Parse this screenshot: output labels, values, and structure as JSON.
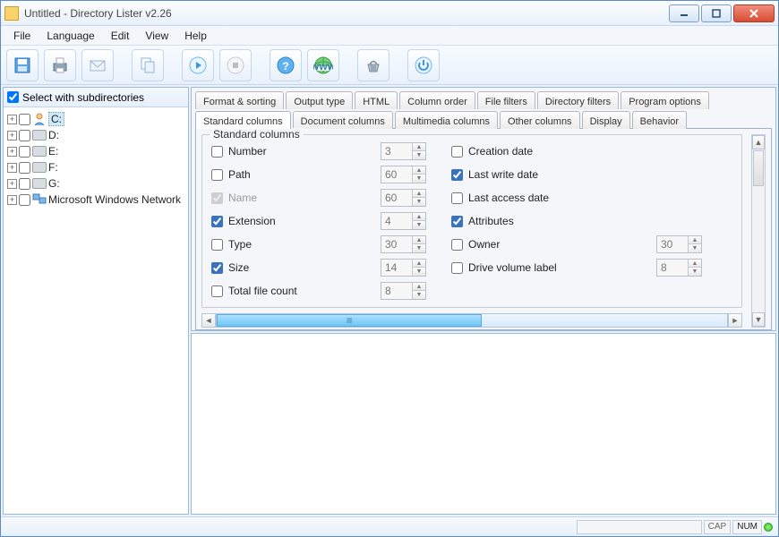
{
  "window": {
    "title": "Untitled - Directory Lister v2.26"
  },
  "menubar": [
    "File",
    "Language",
    "Edit",
    "View",
    "Help"
  ],
  "leftpanel": {
    "checkbox_label": "Select with subdirectories",
    "checkbox_checked": true,
    "tree": [
      {
        "label": "C:",
        "type": "user-drive",
        "selected": true
      },
      {
        "label": "D:",
        "type": "drive"
      },
      {
        "label": "E:",
        "type": "drive"
      },
      {
        "label": "F:",
        "type": "drive"
      },
      {
        "label": "G:",
        "type": "drive"
      },
      {
        "label": "Microsoft Windows Network",
        "type": "network"
      }
    ]
  },
  "tabs_row1": [
    "Format & sorting",
    "Output type",
    "HTML",
    "Column order",
    "File filters",
    "Directory filters",
    "Program options"
  ],
  "tabs_row2": [
    "Standard columns",
    "Document columns",
    "Multimedia columns",
    "Other columns",
    "Display",
    "Behavior"
  ],
  "active_tab": "Standard columns",
  "groupbox_title": "Standard columns",
  "left_fields": [
    {
      "label": "Number",
      "checked": false,
      "value": "3"
    },
    {
      "label": "Path",
      "checked": false,
      "value": "60"
    },
    {
      "label": "Name",
      "checked": true,
      "disabled": true,
      "value": "60"
    },
    {
      "label": "Extension",
      "checked": true,
      "value": "4"
    },
    {
      "label": "Type",
      "checked": false,
      "value": "30"
    },
    {
      "label": "Size",
      "checked": true,
      "value": "14"
    },
    {
      "label": "Total file count",
      "checked": false,
      "value": "8"
    }
  ],
  "right_fields": [
    {
      "label": "Creation date",
      "checked": false
    },
    {
      "label": "Last write date",
      "checked": true
    },
    {
      "label": "Last access date",
      "checked": false
    },
    {
      "label": "Attributes",
      "checked": true
    },
    {
      "label": "Owner",
      "checked": false,
      "value": "30"
    },
    {
      "label": "Drive volume label",
      "checked": false,
      "value": "8"
    }
  ],
  "statusbar": {
    "cap": "CAP",
    "num": "NUM"
  }
}
